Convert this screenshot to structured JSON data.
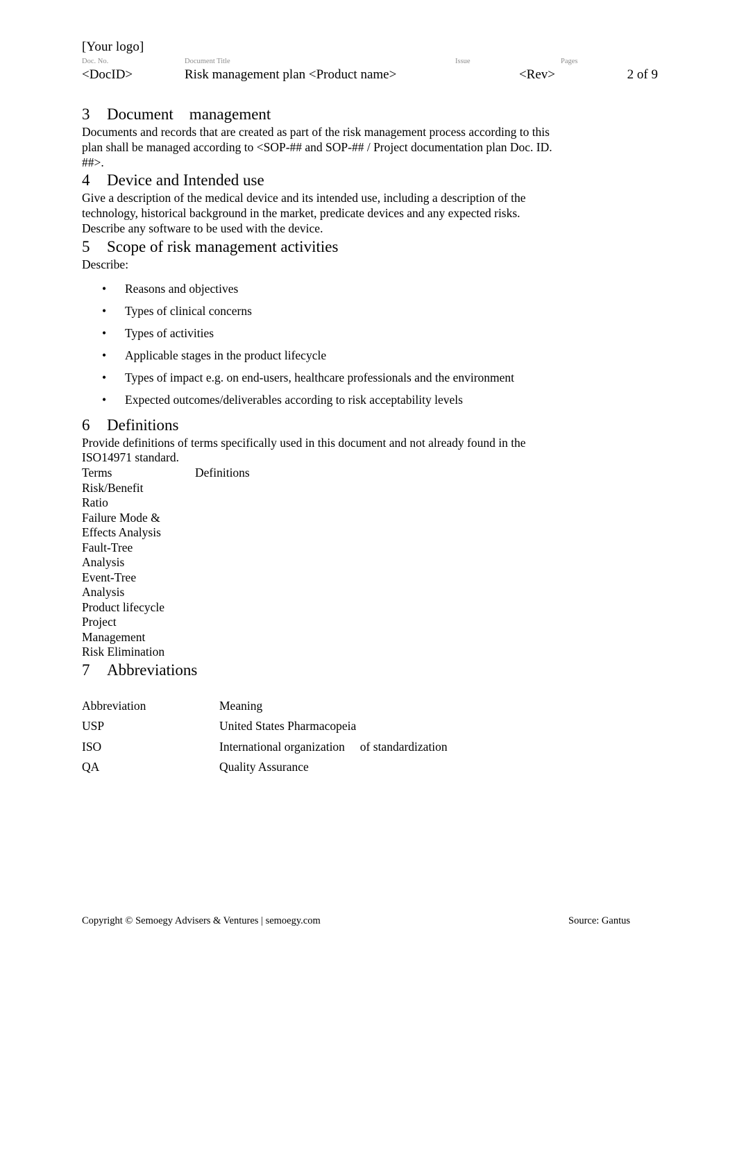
{
  "header": {
    "logo_placeholder": "[Your logo]",
    "columns": [
      {
        "label": "Doc. No.",
        "value": "<DocID>"
      },
      {
        "label": "Document Title",
        "value": "Risk management plan <Product name>"
      },
      {
        "label": "Issue",
        "value": "<Rev>"
      },
      {
        "label": "Pages",
        "value": "2 of 9"
      }
    ]
  },
  "sections": {
    "document_management": {
      "number": "3",
      "title": "Document    management",
      "paragraph": "Documents and records that are created as part of the risk management process according to this plan shall be managed according to <SOP-## and SOP-## / Project documentation plan Doc. ID. ##>."
    },
    "device_intended_use": {
      "number": "4",
      "title": "Device and Intended use",
      "paragraph": "Give a description of the medical device and its intended use, including a description of the technology, historical background in the market, predicate devices and any expected risks. Describe any software to be used with the device."
    },
    "scope": {
      "number": "5",
      "title": "Scope of risk management activities",
      "lead_in": "Describe:",
      "bullet_char": "•",
      "bullets": [
        "Reasons and objectives",
        "Types of clinical concerns",
        "Types of activities",
        "Applicable stages in the product lifecycle",
        "Types of impact e.g. on end-users, healthcare professionals and the environment",
        "Expected outcomes/deliverables according to risk acceptability levels"
      ]
    },
    "definitions": {
      "number": "6",
      "title": "Definitions",
      "paragraph": "Provide definitions of terms specifically used in this document and not already found in the ISO14971 standard.",
      "table": {
        "headers": {
          "term": "Terms",
          "definition": "Definitions"
        },
        "rows": [
          {
            "term": "Risk/Benefit\nRatio",
            "definition": ""
          },
          {
            "term": "Failure Mode &\nEffects Analysis",
            "definition": ""
          },
          {
            "term": "Fault-Tree\nAnalysis",
            "definition": ""
          },
          {
            "term": "Event-Tree\nAnalysis",
            "definition": ""
          },
          {
            "term": "Product lifecycle",
            "definition": ""
          },
          {
            "term": "Project\nManagement",
            "definition": ""
          },
          {
            "term": "Risk Elimination",
            "definition": ""
          }
        ]
      }
    },
    "abbreviations": {
      "number": "7",
      "title": "Abbreviations",
      "table": {
        "headers": {
          "abbreviation": "Abbreviation",
          "meaning": "Meaning"
        },
        "rows": [
          {
            "abbreviation": "USP",
            "meaning": "United States Pharmacopeia"
          },
          {
            "abbreviation": "ISO",
            "meaning": "International organization     of standardization"
          },
          {
            "abbreviation": "QA",
            "meaning": "Quality Assurance"
          }
        ]
      }
    }
  },
  "footer": {
    "copyright": "Copyright © Semoegy Advisers & Ventures | semoegy.com",
    "source": "Source: Gantus"
  }
}
